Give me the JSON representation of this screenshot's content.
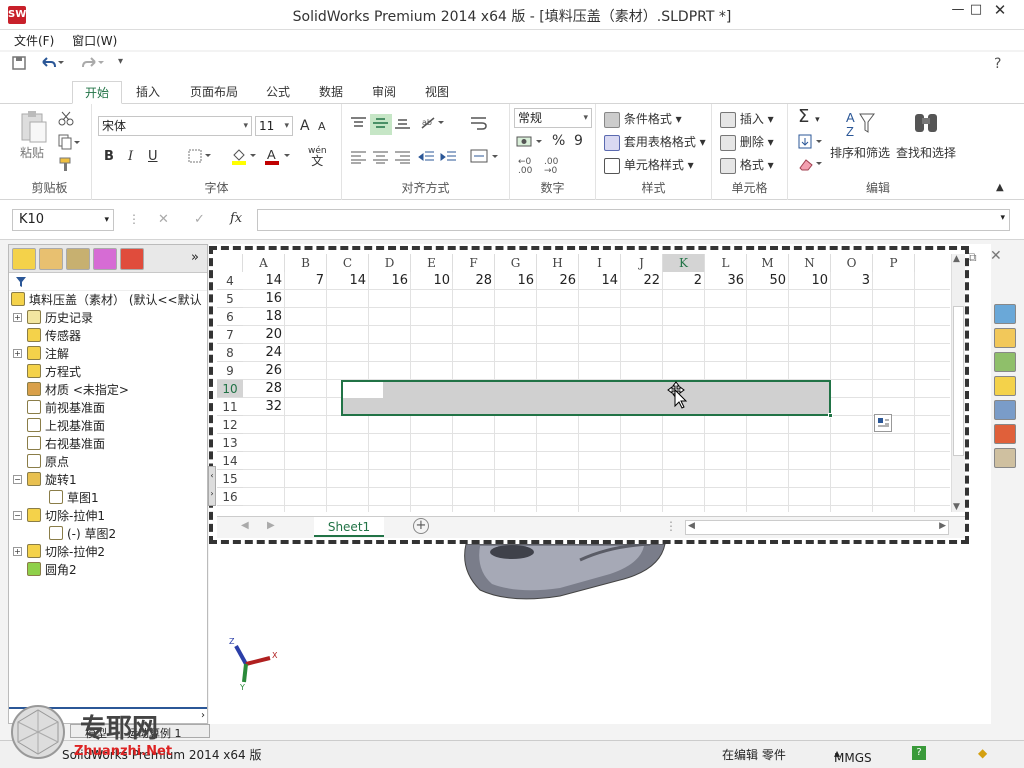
{
  "window": {
    "title": "SolidWorks Premium 2014 x64 版 - [填料压盖（素材）.SLDPRT *]",
    "app_icon": "SW",
    "minimize": "—",
    "maximize": "□",
    "close": "✕"
  },
  "menu": [
    "文件(F)",
    "窗口(W)"
  ],
  "qat": {
    "help": "?"
  },
  "ribbon_tabs": [
    "开始",
    "插入",
    "页面布局",
    "公式",
    "数据",
    "审阅",
    "视图"
  ],
  "ribbon": {
    "clipboard": {
      "paste": "粘贴",
      "label": "剪贴板"
    },
    "font": {
      "name": "宋体",
      "size": "11",
      "bold": "B",
      "italic": "I",
      "underline": "U",
      "label": "字体",
      "grow": "A",
      "shrink": "A",
      "wen": "wén",
      "wen_char": "文"
    },
    "align": {
      "label": "对齐方式"
    },
    "number": {
      "format": "常规",
      "percent": "%",
      "comma": "9",
      "label": "数字"
    },
    "styles": {
      "conditional": "条件格式",
      "table": "套用表格格式",
      "cell": "单元格样式",
      "label": "样式"
    },
    "cells": {
      "insert": "插入",
      "delete": "删除",
      "format": "格式",
      "label": "单元格"
    },
    "edit": {
      "sort": "排序和筛选",
      "find": "查找和选择",
      "label": "编辑",
      "sigma": "Σ"
    }
  },
  "formula_bar": {
    "name_box": "K10",
    "cancel": "✕",
    "enter": "✓",
    "fx": "fx"
  },
  "sheet": {
    "columns": [
      "A",
      "B",
      "C",
      "D",
      "E",
      "F",
      "G",
      "H",
      "I",
      "J",
      "K",
      "L",
      "M",
      "N",
      "O",
      "P"
    ],
    "selected_column": "K",
    "rows": [
      {
        "num": "4",
        "cells": [
          "14",
          "7",
          "14",
          "16",
          "10",
          "28",
          "16",
          "26",
          "14",
          "22",
          "2",
          "36",
          "50",
          "10",
          "3",
          ""
        ]
      },
      {
        "num": "5",
        "cells": [
          "16"
        ]
      },
      {
        "num": "6",
        "cells": [
          "18"
        ]
      },
      {
        "num": "7",
        "cells": [
          "20"
        ]
      },
      {
        "num": "8",
        "cells": [
          "24"
        ]
      },
      {
        "num": "9",
        "cells": [
          "26"
        ]
      },
      {
        "num": "10",
        "cells": [
          "28"
        ]
      },
      {
        "num": "11",
        "cells": [
          "32"
        ]
      },
      {
        "num": "12",
        "cells": []
      },
      {
        "num": "13",
        "cells": []
      },
      {
        "num": "14",
        "cells": []
      },
      {
        "num": "15",
        "cells": []
      },
      {
        "num": "16",
        "cells": []
      }
    ],
    "selected_row": "10",
    "tab": "Sheet1",
    "add_sheet": "+"
  },
  "feature_tree": {
    "root": "填料压盖（素材） (默认<<默认",
    "items": [
      {
        "label": "历史记录",
        "expander": "+"
      },
      {
        "label": "传感器",
        "expander": ""
      },
      {
        "label": "注解",
        "expander": "+"
      },
      {
        "label": "方程式",
        "expander": ""
      },
      {
        "label": "材质 <未指定>",
        "expander": ""
      },
      {
        "label": "前视基准面",
        "expander": ""
      },
      {
        "label": "上视基准面",
        "expander": ""
      },
      {
        "label": "右视基准面",
        "expander": ""
      },
      {
        "label": "原点",
        "expander": ""
      },
      {
        "label": "旋转1",
        "expander": "−"
      },
      {
        "label": "草图1",
        "expander": ""
      },
      {
        "label": "切除-拉伸1",
        "expander": "−"
      },
      {
        "label": "(-) 草图2",
        "expander": ""
      },
      {
        "label": "切除-拉伸2",
        "expander": "+"
      },
      {
        "label": "圆角2",
        "expander": ""
      }
    ],
    "bottom_tabs": [
      "模型",
      "运动算例 1"
    ]
  },
  "triad": {
    "x": "X",
    "y": "Y",
    "z": "Z"
  },
  "status": {
    "left": "SolidWorks Premium 2014 x64 版",
    "editing": "在编辑 零件",
    "units": "MMGS",
    "help": "?"
  },
  "watermark": {
    "text": "专耶网",
    "sub": "Zhuanzhi.Net"
  },
  "colors": {
    "excel_green": "#217346",
    "selection_gray": "#d0d0d0",
    "sw_red": "#c8202a"
  }
}
